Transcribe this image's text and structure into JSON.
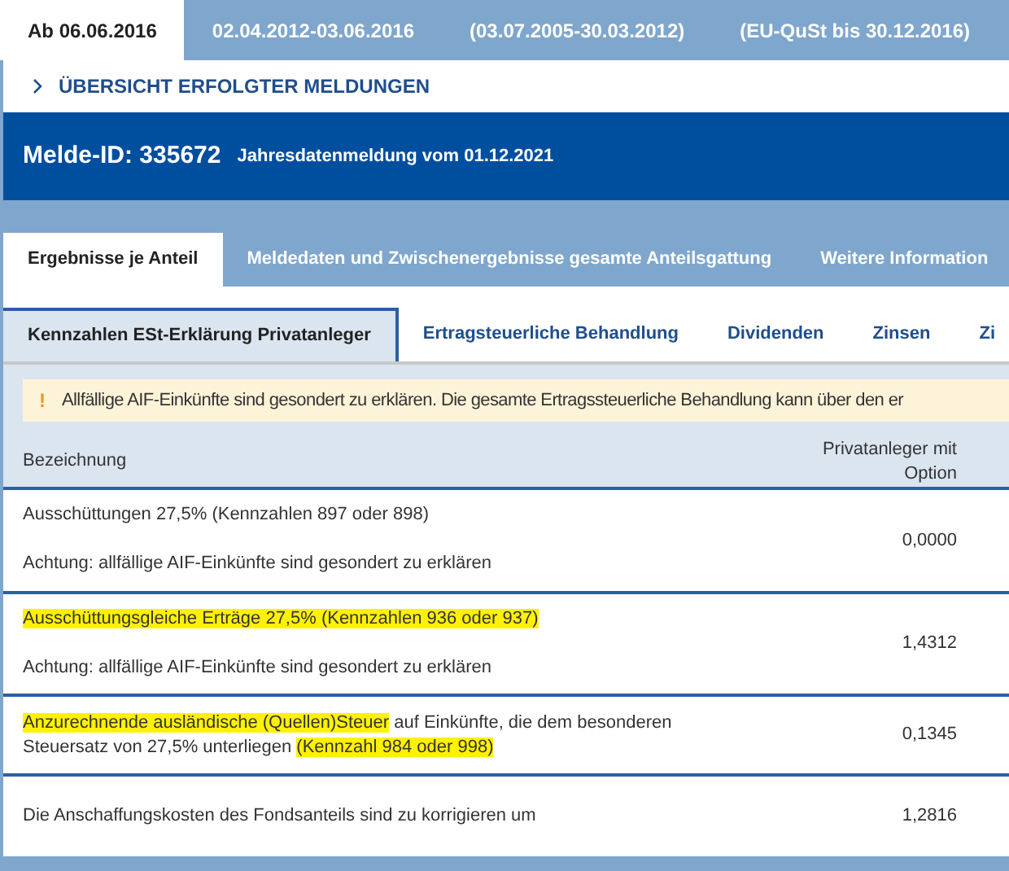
{
  "period_tabs": [
    {
      "label": "Ab 06.06.2016",
      "selected": true
    },
    {
      "label": "02.04.2012-03.06.2016",
      "selected": false
    },
    {
      "label": "(03.07.2005-30.03.2012)",
      "selected": false
    },
    {
      "label": "(EU-QuSt bis 30.12.2016)",
      "selected": false
    }
  ],
  "overview_link": "ÜBERSICHT ERFOLGTER MELDUNGEN",
  "header": {
    "title": "Melde-ID: 335672",
    "subtitle": "Jahresdatenmeldung vom 01.12.2021"
  },
  "main_tabs": [
    {
      "label": "Ergebnisse je Anteil",
      "selected": true
    },
    {
      "label": "Meldedaten und Zwischenergebnisse gesamte Anteilsgattung",
      "selected": false
    },
    {
      "label": "Weitere Information",
      "selected": false
    }
  ],
  "sub_tabs": [
    {
      "label": "Kennzahlen ESt-Erklärung Privatanleger",
      "selected": true
    },
    {
      "label": "Ertragsteuerliche Behandlung",
      "selected": false
    },
    {
      "label": "Dividenden",
      "selected": false
    },
    {
      "label": "Zinsen",
      "selected": false
    },
    {
      "label": "Zi",
      "selected": false
    }
  ],
  "notice": {
    "icon": "!",
    "text": "Allfällige AIF-Einkünfte sind gesondert zu erklären. Die gesamte Ertragssteuerliche Behandlung kann über den er"
  },
  "table": {
    "columns": [
      "Bezeichnung",
      "Privatanleger mit Option"
    ],
    "rows": [
      {
        "label": [
          {
            "text": "Ausschüttungen 27,5% (Kennzahlen 897 oder 898)",
            "highlighted": false
          }
        ],
        "note": "Achtung: allfällige AIF-Einkünfte sind gesondert zu erklären",
        "value": "0,0000"
      },
      {
        "label": [
          {
            "text": "Ausschüttungsgleiche Erträge 27,5% (Kennzahlen 936 oder 937)",
            "highlighted": true
          }
        ],
        "note": "Achtung: allfällige AIF-Einkünfte sind gesondert zu erklären",
        "value": "1,4312"
      },
      {
        "label": [
          {
            "text": "Anzurechnende ausländische (Quellen)Steuer",
            "highlighted": true
          },
          {
            "text": " auf Einkünfte, die dem besonderen Steuersatz von 27,5% unterliegen ",
            "highlighted": false
          },
          {
            "text": "(Kennzahl 984 oder 998)",
            "highlighted": true
          }
        ],
        "value": "0,1345"
      },
      {
        "label": [
          {
            "text": "Die Anschaffungskosten des Fondsanteils sind zu korrigieren um",
            "highlighted": false
          }
        ],
        "value": "1,2816"
      }
    ]
  }
}
